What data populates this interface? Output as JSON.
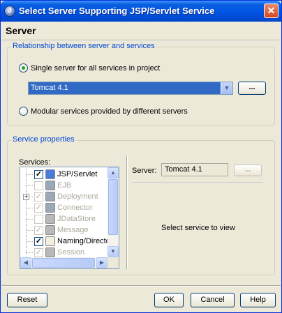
{
  "window": {
    "title": "Select Server Supporting JSP/Servlet Service",
    "close_glyph": "✕"
  },
  "header": {
    "title": "Server"
  },
  "relationship": {
    "group_title": "Relationship between server and services",
    "single_label": "Single server for all services in project",
    "single_selected": true,
    "server_combo_value": "Tomcat 4.1",
    "browse_label": "...",
    "modular_label": "Modular services provided by different servers",
    "modular_selected": false
  },
  "service_properties": {
    "group_title": "Service properties",
    "services_label": "Services:",
    "services": [
      {
        "label": "JSP/Servlet",
        "checked": true,
        "enabled": true,
        "icon": "jsp-servlet-icon",
        "icon_color": "#4a7bd8"
      },
      {
        "label": "EJB",
        "checked": false,
        "enabled": false,
        "icon": "ejb-icon",
        "icon_color": "#9aa8b8"
      },
      {
        "label": "Deployment",
        "checked": true,
        "enabled": false,
        "icon": "deployment-icon",
        "icon_color": "#9aa8b8",
        "expandable": true
      },
      {
        "label": "Connector",
        "checked": true,
        "enabled": false,
        "icon": "connector-icon",
        "icon_color": "#9aa8b8"
      },
      {
        "label": "JDataStore",
        "checked": false,
        "enabled": false,
        "icon": "jdatastore-icon",
        "icon_color": "#b8b8b8"
      },
      {
        "label": "Message",
        "checked": true,
        "enabled": false,
        "icon": "message-icon",
        "icon_color": "#b8b8b8"
      },
      {
        "label": "Naming/Directory",
        "checked": true,
        "enabled": true,
        "icon": "naming-directory-icon",
        "icon_color": "#f2f0dc"
      },
      {
        "label": "Session",
        "checked": true,
        "enabled": false,
        "icon": "session-icon",
        "icon_color": "#b8b8b8"
      }
    ],
    "server_label": "Server:",
    "server_value": "Tomcat 4.1",
    "server_browse_label": "...",
    "placeholder": "Select service to view"
  },
  "buttons": {
    "reset": "Reset",
    "ok": "OK",
    "cancel": "Cancel",
    "help": "Help"
  }
}
